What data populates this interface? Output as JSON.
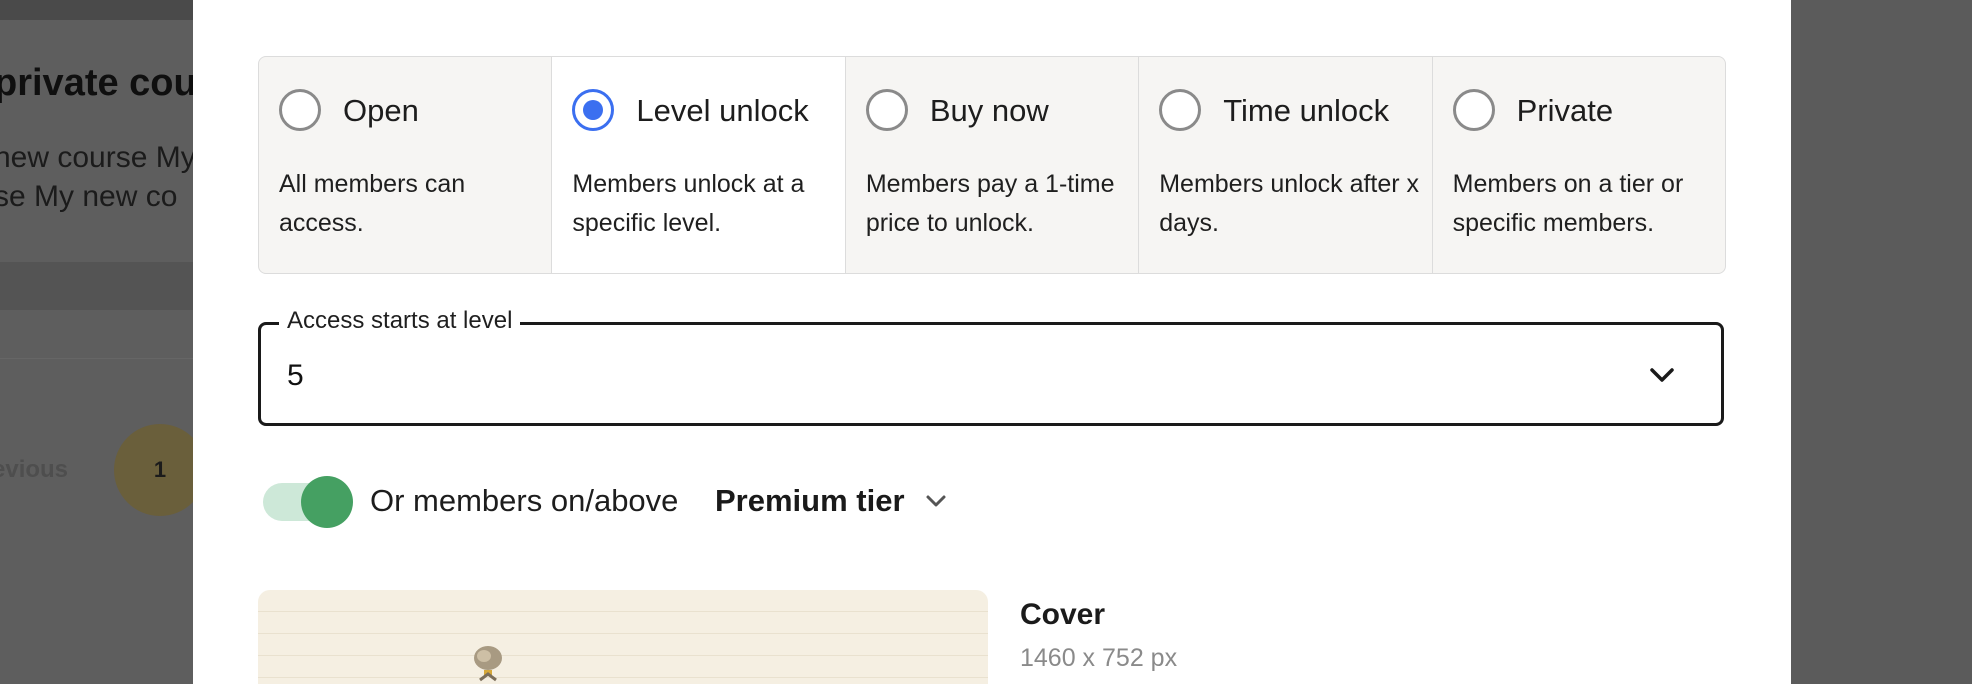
{
  "background_page": {
    "title_fragment": "private cou",
    "description_lines": [
      "new course My",
      "se My new co"
    ],
    "pagination_previous": "evious",
    "pagination_current": "1"
  },
  "access_options": [
    {
      "label": "Open",
      "description": "All members can access.",
      "selected": false
    },
    {
      "label": "Level unlock",
      "description": "Members unlock at a specific level.",
      "selected": true
    },
    {
      "label": "Buy now",
      "description": "Members pay a 1-time price to unlock.",
      "selected": false
    },
    {
      "label": "Time unlock",
      "description": "Members unlock after x days.",
      "selected": false
    },
    {
      "label": "Private",
      "description": "Members on a tier or specific members.",
      "selected": false
    }
  ],
  "level_select": {
    "label": "Access starts at level",
    "value": "5"
  },
  "tier_toggle": {
    "enabled": true,
    "label": "Or members on/above",
    "tier": "Premium tier"
  },
  "cover": {
    "title": "Cover",
    "dimensions": "1460 x 752 px"
  },
  "colors": {
    "radio_selected": "#3b6ff0",
    "toggle_thumb": "#45a062",
    "toggle_track": "#cde8d8",
    "overlay": "#5e5e5e"
  }
}
